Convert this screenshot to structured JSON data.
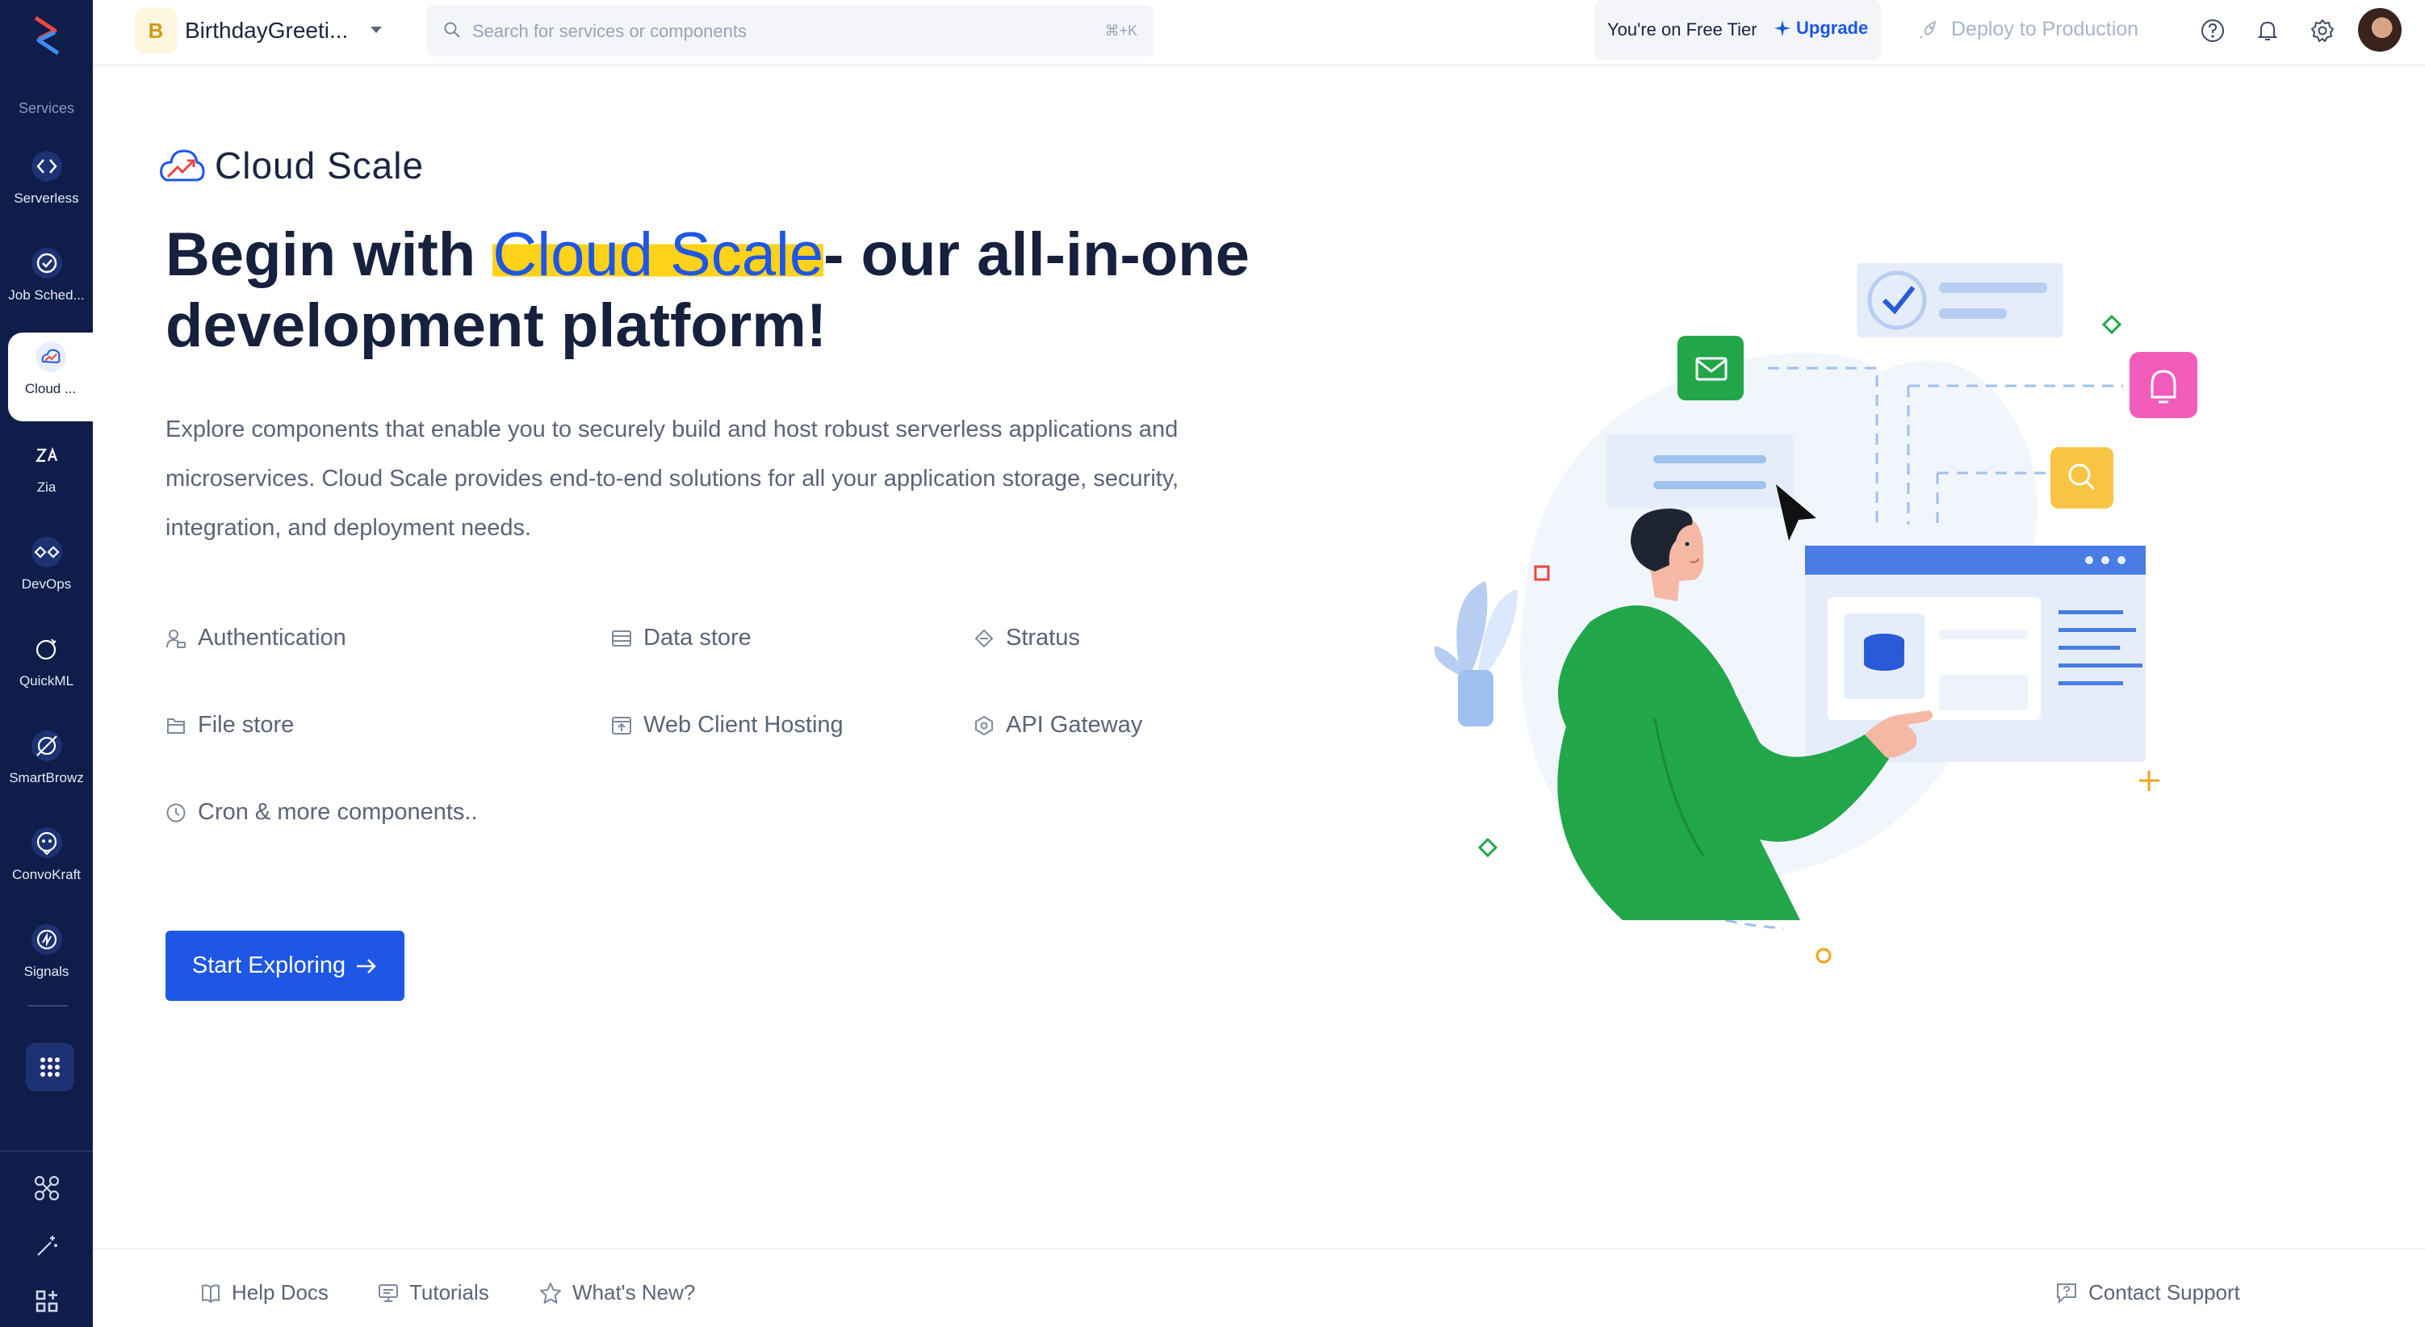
{
  "sidebar": {
    "section_label": "Services",
    "items": [
      {
        "label": "Serverless",
        "icon": "serverless-icon"
      },
      {
        "label": "Job Sched...",
        "icon": "job-scheduling-icon"
      },
      {
        "label": "Cloud ...",
        "icon": "cloud-scale-icon",
        "active": true
      },
      {
        "label": "Zia",
        "icon": "zia-icon"
      },
      {
        "label": "DevOps",
        "icon": "devops-icon"
      },
      {
        "label": "QuickML",
        "icon": "quickml-icon"
      },
      {
        "label": "SmartBrowz",
        "icon": "smartbrowz-icon"
      },
      {
        "label": "ConvoKraft",
        "icon": "convokraft-icon"
      },
      {
        "label": "Signals",
        "icon": "signals-icon"
      }
    ]
  },
  "topbar": {
    "project_initial": "B",
    "project_name": "BirthdayGreeti...",
    "search_placeholder": "Search for services or components",
    "search_shortcut": "⌘+K",
    "tier_text": "You're on Free Tier",
    "upgrade_label": "Upgrade",
    "deploy_label": "Deploy to Production"
  },
  "content": {
    "brand_title": "Cloud Scale",
    "headline_prefix": "Begin with ",
    "headline_highlight": "Cloud Scale",
    "headline_suffix_line1": "- our all-in-one",
    "headline_line2": "development platform!",
    "description": "Explore components that enable you to securely build and host robust serverless applications and microservices. Cloud Scale provides end-to-end solutions for all your application storage, security, integration, and deployment needs.",
    "features": [
      {
        "label": "Authentication",
        "icon": "authentication-icon"
      },
      {
        "label": "Data store",
        "icon": "data-store-icon"
      },
      {
        "label": "Stratus",
        "icon": "stratus-icon"
      },
      {
        "label": "File store",
        "icon": "file-store-icon"
      },
      {
        "label": "Web Client Hosting",
        "icon": "web-client-hosting-icon"
      },
      {
        "label": "API Gateway",
        "icon": "api-gateway-icon"
      },
      {
        "label": "Cron & more components..",
        "icon": "cron-icon"
      }
    ],
    "cta_label": "Start Exploring"
  },
  "footer": {
    "help_docs": "Help Docs",
    "tutorials": "Tutorials",
    "whats_new": "What's New?",
    "contact_support": "Contact Support"
  },
  "colors": {
    "sidebar_bg": "#0e1d4a",
    "accent": "#1e56e6",
    "highlight": "#ffd21a",
    "illustration_green": "#22a64a"
  }
}
